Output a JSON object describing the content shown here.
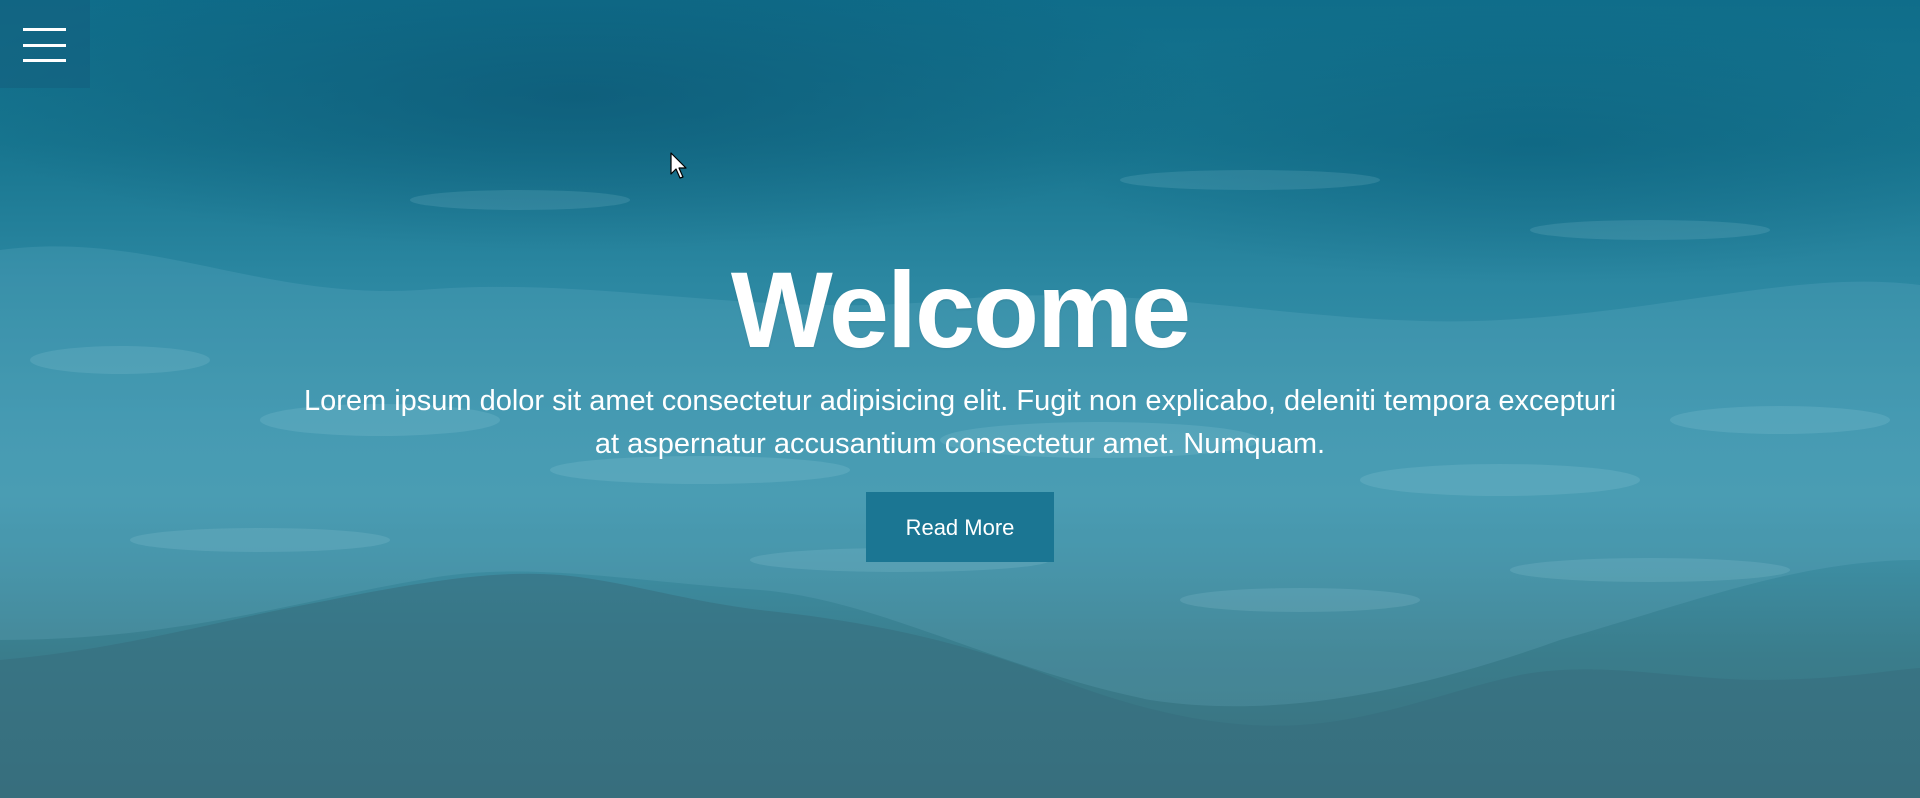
{
  "hero": {
    "title": "Welcome",
    "text": "Lorem ipsum dolor sit amet consectetur adipisicing elit. Fugit non explicabo, deleniti tempora excepturi at aspernatur accusantium consectetur amet. Numquam.",
    "button_label": "Read More"
  },
  "menu": {
    "icon": "hamburger-menu-icon"
  },
  "colors": {
    "overlay_teal": "#1b7693",
    "text": "#ffffff",
    "sea_dark": "#0f6d8a",
    "sea_light": "#4096ad",
    "sand": "#396f7c"
  }
}
